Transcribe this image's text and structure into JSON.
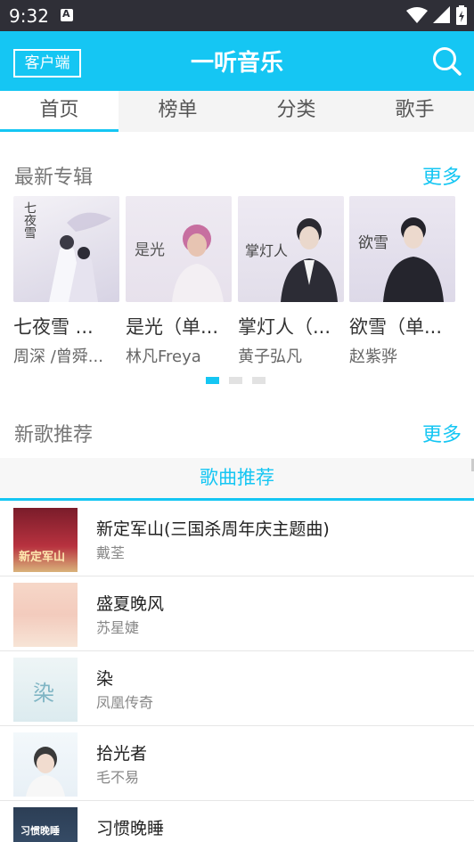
{
  "status_bar": {
    "time": "9:32"
  },
  "header": {
    "client_label": "客户端",
    "title": "一听音乐"
  },
  "tabs": [
    {
      "label": "首页",
      "active": true
    },
    {
      "label": "榜单",
      "active": false
    },
    {
      "label": "分类",
      "active": false
    },
    {
      "label": "歌手",
      "active": false
    }
  ],
  "albums_section": {
    "title": "最新专辑",
    "more": "更多",
    "albums": [
      {
        "name": "七夜雪 ...",
        "artist": "周深 /曾舜...",
        "cover_text": "七夜雪"
      },
      {
        "name": "是光（单...",
        "artist": "林凡Freya",
        "cover_text": "是光"
      },
      {
        "name": "掌灯人（...",
        "artist": "黄子弘凡",
        "cover_text": "掌灯人"
      },
      {
        "name": "欲雪（单...",
        "artist": "赵紫骅",
        "cover_text": "欲雪"
      }
    ],
    "page_count": 3,
    "current_page": 1
  },
  "songs_section": {
    "title": "新歌推荐",
    "more": "更多",
    "tab_label": "歌曲推荐",
    "songs": [
      {
        "title": "新定军山(三国杀周年庆主题曲)",
        "singer": "戴荃",
        "thumb_text": "新定军山"
      },
      {
        "title": "盛夏晚风",
        "singer": "苏星婕",
        "thumb_text": ""
      },
      {
        "title": "染",
        "singer": "凤凰传奇",
        "thumb_text": "染"
      },
      {
        "title": "拾光者",
        "singer": "毛不易",
        "thumb_text": ""
      },
      {
        "title": "习惯晚睡",
        "singer": "",
        "thumb_text": "习惯晚睡"
      }
    ]
  }
}
